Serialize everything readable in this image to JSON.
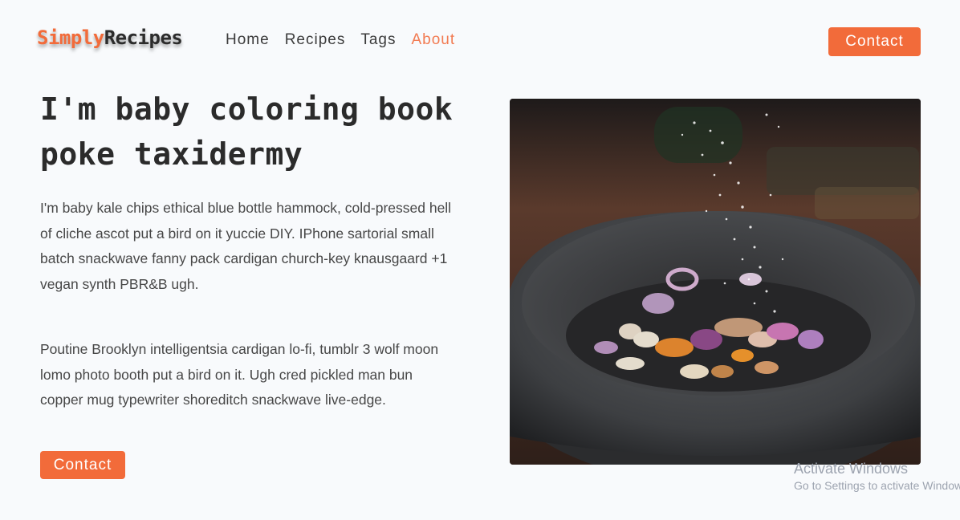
{
  "brand": {
    "part1": "Simply",
    "part2": "Recipes"
  },
  "nav": {
    "links": [
      {
        "label": "Home"
      },
      {
        "label": "Recipes"
      },
      {
        "label": "Tags"
      },
      {
        "label": "About"
      }
    ],
    "active": "About",
    "contact_label": "Contact"
  },
  "hero": {
    "title": "I'm baby coloring book poke taxidermy",
    "paragraph1": "I'm baby kale chips ethical blue bottle hammock, cold-pressed hell of cliche ascot put a bird on it yuccie DIY. IPhone sartorial small batch snackwave fanny pack cardigan church-key knausgaard +1 vegan synth PBR&B ugh.",
    "paragraph2": "Poutine Brooklyn intelligentsia cardigan lo-fi, tumblr 3 wolf moon lomo photo booth put a bird on it. Ugh cred pickled man bun copper mug typewriter shoreditch snackwave live-edge.",
    "contact_label": "Contact"
  },
  "watermark": {
    "line1": "Activate Windows",
    "line2": "Go to Settings to activate Windows."
  },
  "colors": {
    "accent": "#f26b3a",
    "background": "#f8fafc"
  }
}
